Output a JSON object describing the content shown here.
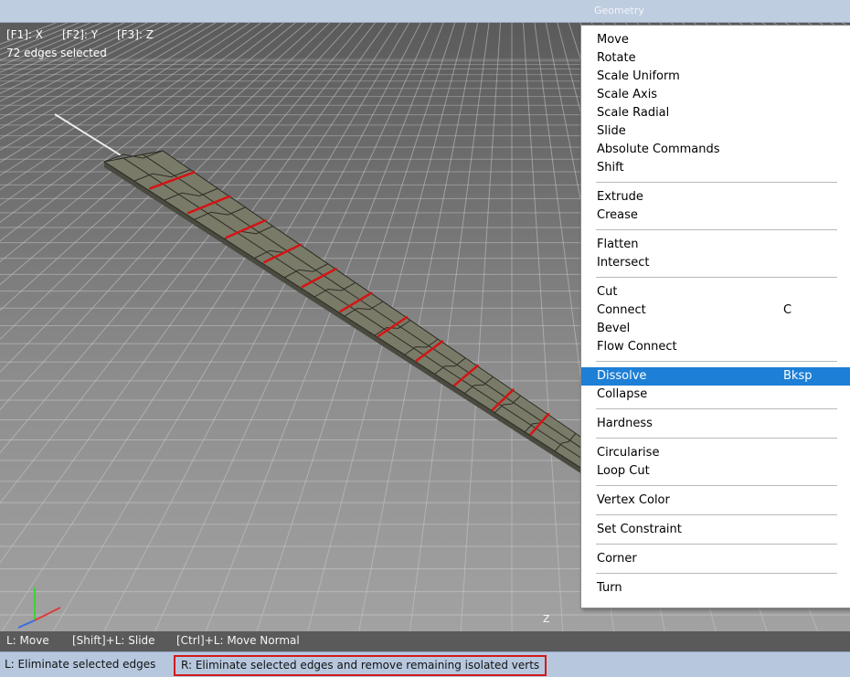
{
  "window": {
    "panel_title": "Geometry"
  },
  "viewport": {
    "shortcut_x": "[F1]: X",
    "shortcut_y": "[F2]: Y",
    "shortcut_z": "[F3]: Z",
    "selection_status": "72 edges selected",
    "axis_z_label": "Z"
  },
  "viewport_hints": {
    "left_click": "L: Move",
    "shift_click": "[Shift]+L: Slide",
    "ctrl_click": "[Ctrl]+L: Move Normal"
  },
  "status_bar": {
    "left_hint": "L: Eliminate selected edges",
    "right_hint": "R: Eliminate selected edges and remove remaining isolated verts"
  },
  "context_menu": {
    "groups": [
      [
        {
          "label": "Move",
          "shortcut": ""
        },
        {
          "label": "Rotate",
          "shortcut": ""
        },
        {
          "label": "Scale Uniform",
          "shortcut": ""
        },
        {
          "label": "Scale Axis",
          "shortcut": ""
        },
        {
          "label": "Scale Radial",
          "shortcut": ""
        },
        {
          "label": "Slide",
          "shortcut": ""
        },
        {
          "label": "Absolute Commands",
          "shortcut": ""
        },
        {
          "label": "Shift",
          "shortcut": ""
        }
      ],
      [
        {
          "label": "Extrude",
          "shortcut": ""
        },
        {
          "label": "Crease",
          "shortcut": ""
        }
      ],
      [
        {
          "label": "Flatten",
          "shortcut": ""
        },
        {
          "label": "Intersect",
          "shortcut": ""
        }
      ],
      [
        {
          "label": "Cut",
          "shortcut": ""
        },
        {
          "label": "Connect",
          "shortcut": "C"
        },
        {
          "label": "Bevel",
          "shortcut": ""
        },
        {
          "label": "Flow Connect",
          "shortcut": ""
        }
      ],
      [
        {
          "label": "Dissolve",
          "shortcut": "Bksp",
          "highlighted": true
        },
        {
          "label": "Collapse",
          "shortcut": ""
        }
      ],
      [
        {
          "label": "Hardness",
          "shortcut": ""
        }
      ],
      [
        {
          "label": "Circularise",
          "shortcut": ""
        },
        {
          "label": "Loop Cut",
          "shortcut": ""
        }
      ],
      [
        {
          "label": "Vertex Color",
          "shortcut": ""
        }
      ],
      [
        {
          "label": "Set Constraint",
          "shortcut": ""
        }
      ],
      [
        {
          "label": "Corner",
          "shortcut": ""
        }
      ],
      [
        {
          "label": "Turn",
          "shortcut": ""
        }
      ]
    ]
  },
  "colors": {
    "menu_highlight": "#1d7fd6",
    "selected_edge": "#d41414",
    "mesh_face": "#7a7a68",
    "status_bar": "#b7c8de",
    "status_outline": "#d11a1a"
  }
}
